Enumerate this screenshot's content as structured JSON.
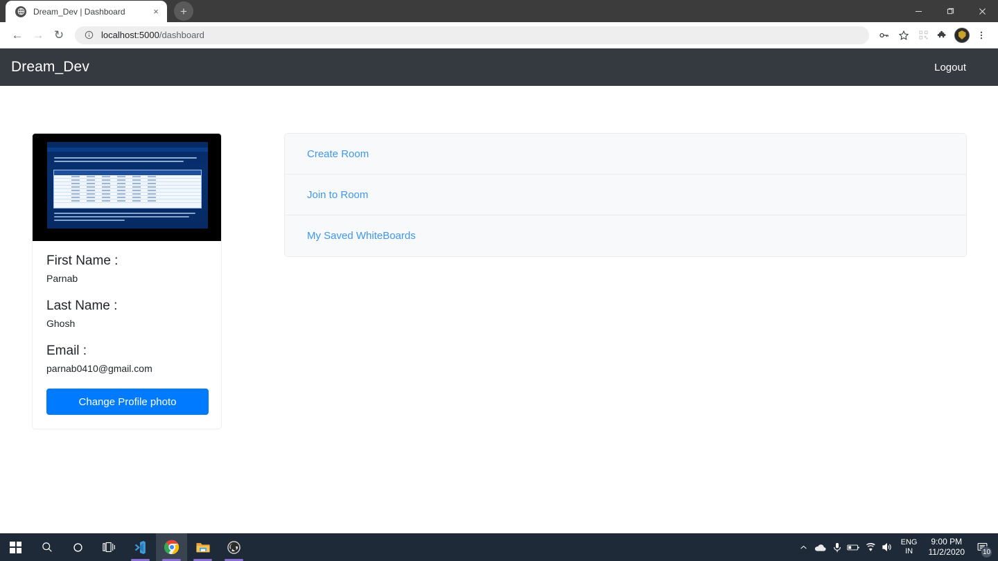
{
  "browser": {
    "tab": {
      "title": "Dream_Dev | Dashboard",
      "favicon": "globe-icon",
      "close": "×"
    },
    "new_tab_label": "+",
    "window_controls": {
      "minimize": "minimize-icon",
      "maximize": "maximize-icon",
      "close": "close-icon"
    },
    "nav": {
      "back": "←",
      "forward": "→",
      "reload": "↻"
    },
    "omnibox": {
      "info_icon": "ⓘ",
      "host": "localhost:5000",
      "path": "/dashboard"
    },
    "toolbar_icons": [
      {
        "name": "password-key-icon",
        "glyph": "⚷"
      },
      {
        "name": "bookmark-star-icon",
        "glyph": "☆"
      },
      {
        "name": "qr-code-icon",
        "glyph": "▒"
      },
      {
        "name": "extensions-puzzle-icon",
        "glyph": "❖"
      },
      {
        "name": "profile-avatar-icon",
        "glyph": ""
      },
      {
        "name": "chrome-menu-icon",
        "glyph": "⋮"
      }
    ]
  },
  "app": {
    "brand": "Dream_Dev",
    "logout_label": "Logout",
    "navbar_color": "#343a40"
  },
  "profile": {
    "photo_alt": "profile-photo-document-screenshot",
    "fields": [
      {
        "label": "First Name :",
        "value": "Parnab"
      },
      {
        "label": "Last Name :",
        "value": "Ghosh"
      },
      {
        "label": "Email :",
        "value": "parnab0410@gmail.com"
      }
    ],
    "change_photo_button": "Change Profile photo",
    "button_color": "#007bff"
  },
  "actions": {
    "link_color": "#3f96f0",
    "items": [
      {
        "label": "Create Room"
      },
      {
        "label": "Join to Room"
      },
      {
        "label": "My Saved WhiteBoards"
      }
    ]
  },
  "taskbar": {
    "items": [
      {
        "name": "start-button",
        "icon": "windows-logo-icon"
      },
      {
        "name": "search-button",
        "icon": "search-icon"
      },
      {
        "name": "cortana-button",
        "icon": "cortana-circle-icon"
      },
      {
        "name": "task-view-button",
        "icon": "task-view-icon"
      },
      {
        "name": "vscode-button",
        "icon": "vscode-icon"
      },
      {
        "name": "chrome-button",
        "icon": "chrome-icon"
      },
      {
        "name": "file-explorer-button",
        "icon": "folder-icon"
      },
      {
        "name": "obs-button",
        "icon": "obs-icon"
      }
    ],
    "tray": {
      "chevron": "∧",
      "onedrive": "☁",
      "microphone": "ᵓ",
      "battery": "▭",
      "wifi": "◠",
      "volume": "◁",
      "language_top": "ENG",
      "language_bottom": "IN",
      "time": "9:00 PM",
      "date": "11/2/2020",
      "notification_count": "10"
    }
  }
}
